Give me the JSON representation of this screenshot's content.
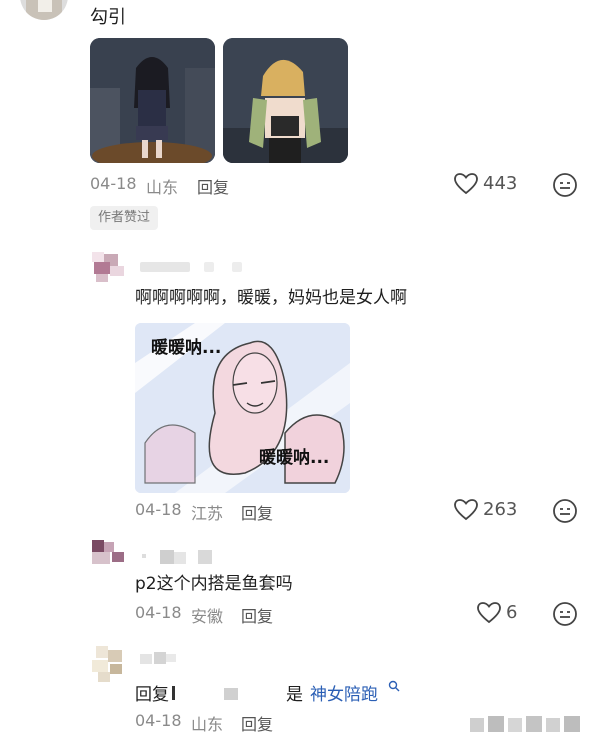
{
  "comment1": {
    "text": "勾引",
    "date": "04-18",
    "location": "山东",
    "reply_label": "回复",
    "likes": "443",
    "author_badge": "作者赞过"
  },
  "comment2": {
    "text": "啊啊啊啊啊，暖暖，妈妈也是女人啊",
    "sticker_text_top": "暖暖呐...",
    "sticker_text_bottom": "暖暖呐...",
    "date": "04-18",
    "location": "江苏",
    "reply_label": "回复",
    "likes": "263"
  },
  "comment3": {
    "text": "p2这个内搭是鱼套吗",
    "date": "04-18",
    "location": "安徽",
    "reply_label": "回复",
    "likes": "6"
  },
  "comment4": {
    "prefix": "回复",
    "middle": "是",
    "link": "神女陪跑",
    "date": "04-18",
    "location": "山东",
    "reply_label": "回复"
  },
  "icons": {
    "like": "heart-outline-icon",
    "emoji": "smiley-face-icon",
    "link": "search-link-icon"
  },
  "colors": {
    "link": "#2b5fb5",
    "meta": "#8a8a8a"
  }
}
